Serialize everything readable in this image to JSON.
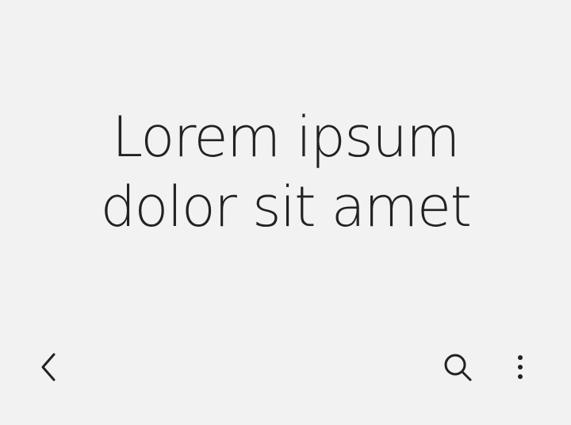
{
  "header": {
    "title_line_1": "Lorem ipsum",
    "title_line_2": "dolor sit amet"
  },
  "toolbar": {
    "back_icon": "chevron-left-icon",
    "search_icon": "search-icon",
    "more_icon": "more-vertical-icon"
  },
  "colors": {
    "background": "#f2f2f2",
    "text": "#222222",
    "icon": "#222222"
  }
}
